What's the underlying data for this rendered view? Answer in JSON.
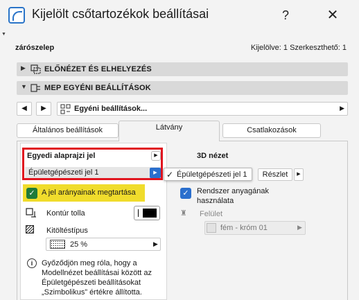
{
  "window": {
    "title": "Kijelölt csőtartozékok beállításai",
    "help": "?",
    "close": "✕"
  },
  "header": {
    "element_name": "zárószelep",
    "selection_status": "Kijelölve: 1 Szerkeszthető: 1"
  },
  "sections": [
    {
      "label": "ELŐNÉZET ÉS ELHELYEZÉS",
      "arrow": "▶",
      "icon": "preview-placement-icon"
    },
    {
      "label": "MEP EGYÉNI BEÁLLÍTÁSOK",
      "arrow": "▼",
      "icon": "mep-settings-icon"
    }
  ],
  "nav": {
    "prev": "◀",
    "next": "▶",
    "field_text": "Egyéni beállítások...",
    "field_arrow": "▶"
  },
  "tabs": [
    {
      "label": "Általános beállítások",
      "active": false
    },
    {
      "label": "Látvány",
      "active": true
    },
    {
      "label": "Csatlakozások",
      "active": false
    }
  ],
  "left_panel": {
    "title": "Egyedi alaprajzi jel",
    "title_btn": "▶",
    "dropdown_value": "Épületgépészeti jel 1",
    "dropdown_btn": "▶",
    "keep_proportions_label": "A jel arányainak megtartása",
    "keep_proportions_checked": true,
    "contour_pen_label": "Kontúr tolla",
    "fill_type_label": "Kitöltéstípus",
    "fill_value": "25 %",
    "fill_arrow": "▶",
    "info_text": "Győződjön meg róla, hogy a Modellnézet beállításai között az Épületgépészeti beállításokat „Szimbolikus” értékre állította."
  },
  "popup": {
    "check": "✓",
    "text": "Épületgépészeti jel 1"
  },
  "right_panel": {
    "title": "3D nézet",
    "detail_button": "Részlet",
    "detail_arrow": "▶",
    "use_system_material_label": "Rendszer anyagának használata",
    "use_system_material_checked": true,
    "surface_label": "Felület",
    "material_value": "fém - króm 01",
    "material_arrow": "▶"
  },
  "colors": {
    "accent": "#2b6fcd",
    "highlight_red": "#e0151f",
    "highlight_yellow": "#f0dc2c",
    "checkbox_green": "#1f7a3a"
  }
}
